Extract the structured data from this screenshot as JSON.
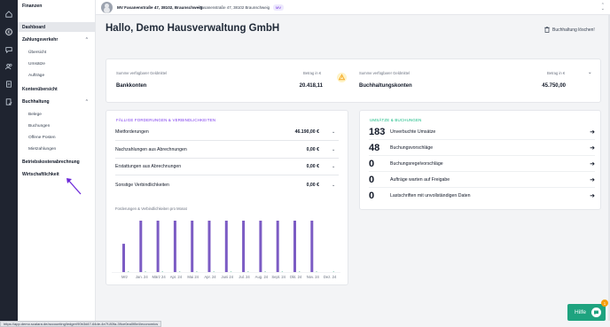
{
  "sidebar": {
    "header": "Finanzen",
    "items": [
      {
        "label": "Dashboard",
        "type": "item",
        "active": true
      },
      {
        "label": "Zahlungsverkehr",
        "type": "group"
      },
      {
        "label": "Übersicht",
        "type": "sub"
      },
      {
        "label": "Umsätze",
        "type": "sub"
      },
      {
        "label": "Aufträge",
        "type": "sub"
      },
      {
        "label": "Kontenübersicht",
        "type": "item"
      },
      {
        "label": "Buchhaltung",
        "type": "group"
      },
      {
        "label": "Belege",
        "type": "sub"
      },
      {
        "label": "Buchungen",
        "type": "sub"
      },
      {
        "label": "Offene Posten",
        "type": "sub"
      },
      {
        "label": "Mietzahlungen",
        "type": "sub"
      },
      {
        "label": "Betriebskostenabrechnung",
        "type": "item"
      },
      {
        "label": "Wirtschaftlichkeit",
        "type": "item"
      }
    ]
  },
  "rail": {
    "icons": [
      "home-icon",
      "euro-icon",
      "chat-icon",
      "users-icon",
      "document-icon",
      "file-check-icon"
    ]
  },
  "topbar": {
    "property": "MV Fasanenstraße 47, 38102, Braunschweig",
    "address": "Fasanenstraße 47, 38102 Braunschweig",
    "badge": "MV"
  },
  "main": {
    "greeting": "Hallo, Demo Hausverwaltung GmbH",
    "delete_label": "Buchhaltung löschen!"
  },
  "summary": {
    "left": {
      "caption": "Summe verfügbarer Geldmittel",
      "amount_caption": "Betrag in €",
      "label": "Bankkonten",
      "value": "20.418,11"
    },
    "right": {
      "caption": "Summe verfügbarer Geldmittel",
      "amount_caption": "Betrag in €",
      "label": "Buchhaltungskonten",
      "value": "45.750,00"
    }
  },
  "receivables": {
    "title": "FÄLLIGE FORDERUNGEN & VERBINDLICHKEITEN",
    "rows": [
      {
        "label": "Mietforderungen",
        "value": "46.190,00 €"
      },
      {
        "label": "Nachzahlungen aus Abrechnungen",
        "value": "0,00 €"
      },
      {
        "label": "Erstattungen aus Abrechnungen",
        "value": "0,00 €"
      },
      {
        "label": "Sonstige Verbindlichkeiten",
        "value": "0,00 €"
      }
    ],
    "chart_title": "Forderungen & Verbindlichkeiten pro Monat"
  },
  "bookings": {
    "title": "UMSÄTZE & BUCHUNGEN",
    "rows": [
      {
        "count": "183",
        "label": "Unverbuchte Umsätze"
      },
      {
        "count": "48",
        "label": "Buchungsvorschläge"
      },
      {
        "count": "0",
        "label": "Buchungsregelvorschläge"
      },
      {
        "count": "0",
        "label": "Aufträge warten auf Freigabe"
      },
      {
        "count": "0",
        "label": "Lastschriften mit unvollständigen Daten"
      }
    ]
  },
  "chart_data": {
    "type": "bar",
    "title": "Forderungen & Verbindlichkeiten pro Monat",
    "categories": [
      "Mrz",
      "Jan. 24",
      "März 24",
      "Apr. 24",
      "Mai 24",
      "Apr. 24",
      "Juni 24",
      "Jul. 24",
      "Aug. 24",
      "Sept. 24",
      "Okt. 24",
      "Nov. 24",
      "Dez. 24"
    ],
    "values": [
      0.55,
      1.0,
      1.0,
      1.0,
      1.0,
      1.0,
      1.0,
      1.0,
      1.0,
      1.0,
      1.0,
      1.0,
      0
    ],
    "color": "#7c5cc4"
  },
  "help": {
    "label": "Hilfe",
    "badge": "1"
  },
  "status_url": "https://app.demo.scalara.de/accounting/ledger/90b3d47-64de-4e7f-80fa-39ce0ea0f8e4/economics"
}
